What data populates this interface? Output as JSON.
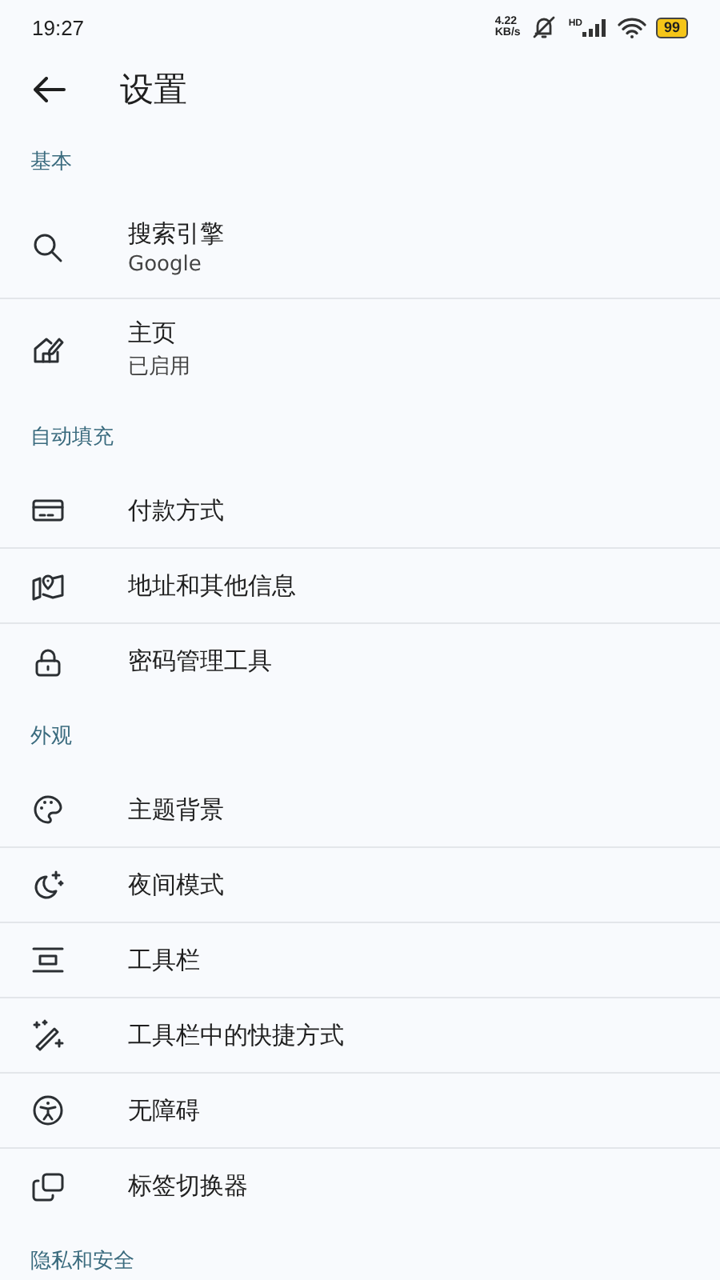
{
  "status_bar": {
    "time": "19:27",
    "net_speed": "4.22",
    "net_unit": "KB/s",
    "network_label": "HD",
    "battery": "99"
  },
  "app_bar": {
    "title": "设置"
  },
  "sections": [
    {
      "title": "基本",
      "items": [
        {
          "kind": "search",
          "label": "搜索引擎",
          "subtitle": "Google"
        },
        {
          "kind": "home",
          "label": "主页",
          "subtitle": "已启用"
        }
      ]
    },
    {
      "title": "自动填充",
      "items": [
        {
          "kind": "card",
          "label": "付款方式"
        },
        {
          "kind": "map",
          "label": "地址和其他信息"
        },
        {
          "kind": "lock",
          "label": "密码管理工具"
        }
      ]
    },
    {
      "title": "外观",
      "items": [
        {
          "kind": "palette",
          "label": "主题背景"
        },
        {
          "kind": "moon",
          "label": "夜间模式"
        },
        {
          "kind": "toolbar",
          "label": "工具栏"
        },
        {
          "kind": "wand",
          "label": "工具栏中的快捷方式"
        },
        {
          "kind": "accessibility",
          "label": "无障碍"
        },
        {
          "kind": "tabs",
          "label": "标签切换器"
        }
      ]
    },
    {
      "title": "隐私和安全"
    }
  ]
}
